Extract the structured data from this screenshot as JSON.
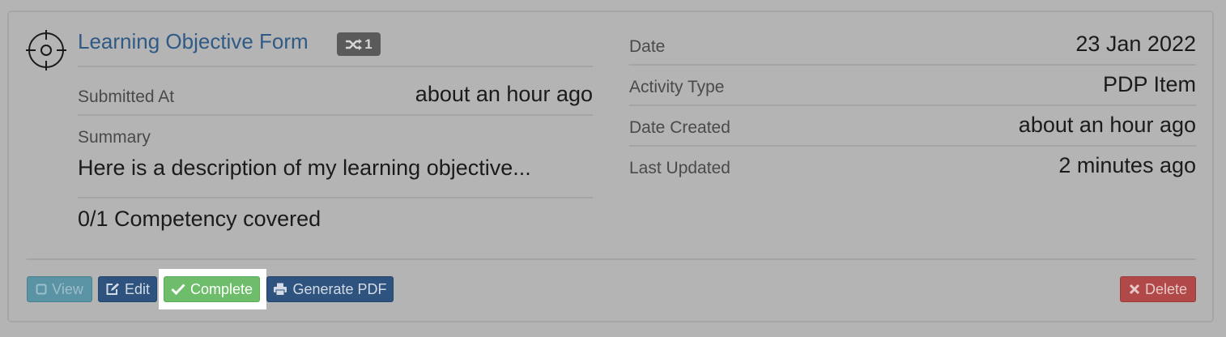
{
  "card": {
    "title": "Learning Objective Form",
    "badge_count": "1",
    "left": {
      "submitted_label": "Submitted At",
      "submitted_value": "about an hour ago",
      "summary_label": "Summary",
      "summary_value": "Here is a description of my learning objective...",
      "competency_text": "0/1 Competency covered"
    },
    "right": {
      "date_label": "Date",
      "date_value": "23 Jan 2022",
      "activity_label": "Activity Type",
      "activity_value": "PDP Item",
      "created_label": "Date Created",
      "created_value": "about an hour ago",
      "updated_label": "Last Updated",
      "updated_value": "2 minutes ago"
    }
  },
  "actions": {
    "view": "View",
    "edit": "Edit",
    "complete": "Complete",
    "generate_pdf": "Generate PDF",
    "delete": "Delete"
  },
  "icons": {
    "title_icon": "crosshair-target-icon",
    "badge_icon": "shuffle-icon",
    "view_icon": "square-icon",
    "edit_icon": "edit-icon",
    "complete_icon": "check-icon",
    "pdf_icon": "print-icon",
    "delete_icon": "x-icon"
  }
}
